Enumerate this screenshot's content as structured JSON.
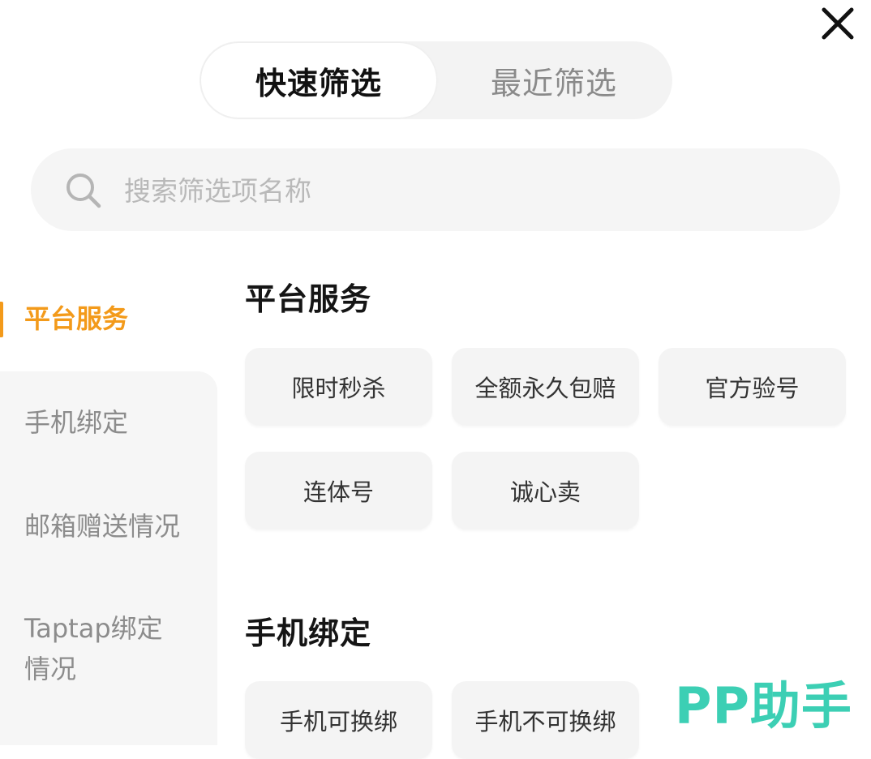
{
  "tabs": {
    "quick": "快速筛选",
    "recent": "最近筛选"
  },
  "search": {
    "placeholder": "搜索筛选项名称",
    "value": ""
  },
  "sidebar": {
    "items": [
      {
        "label": "平台服务"
      },
      {
        "label": "手机绑定"
      },
      {
        "label": "邮箱赠送情况"
      },
      {
        "label": "Taptap绑定",
        "label2": "情况"
      }
    ]
  },
  "sections": [
    {
      "title": "平台服务",
      "chips": [
        "限时秒杀",
        "全额永久包赔",
        "官方验号",
        "连体号",
        "诚心卖"
      ]
    },
    {
      "title": "手机绑定",
      "chips": [
        "手机可换绑",
        "手机不可换绑"
      ]
    }
  ],
  "watermark": "PP助手",
  "colors": {
    "accent": "#f39a1a",
    "watermark": "#3ccfb4"
  },
  "icons": {
    "close": "close-icon",
    "search": "search-icon"
  }
}
